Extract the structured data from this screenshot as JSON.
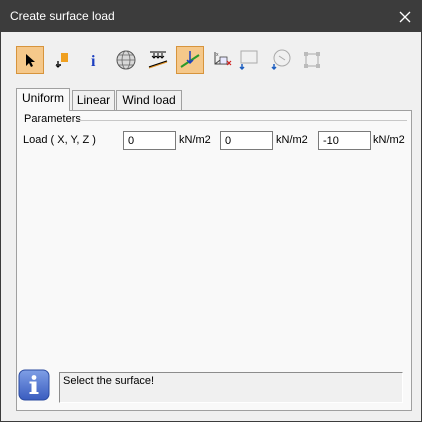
{
  "window": {
    "title": "Create surface load"
  },
  "toolbar": {
    "buttons": [
      {
        "icon": "select-arrow-icon",
        "active": true
      },
      {
        "icon": "surface-pick-icon",
        "active": false
      },
      {
        "icon": "info-icon",
        "active": false
      },
      {
        "icon": "sphere-icon",
        "active": false
      },
      {
        "icon": "load-arrows-icon",
        "active": false
      },
      {
        "icon": "surface-load-icon",
        "active": true
      },
      {
        "icon": "axes-icon",
        "active": false
      },
      {
        "icon": "rectangle-icon",
        "active": false
      },
      {
        "icon": "circle-icon",
        "active": false
      },
      {
        "icon": "polygon-icon",
        "active": false
      }
    ]
  },
  "tabs": [
    {
      "label": "Uniform",
      "selected": true
    },
    {
      "label": "Linear",
      "selected": false
    },
    {
      "label": "Wind load",
      "selected": false
    }
  ],
  "parameters": {
    "group_label": "Parameters",
    "load_label": "Load ( X, Y, Z )",
    "x_value": "0",
    "y_value": "0",
    "z_value": "-10",
    "unit": "kN/m2"
  },
  "status": {
    "message": "Select the surface!"
  },
  "colors": {
    "titlebar": "#3c3c3c",
    "active_button": "#f5c88a",
    "info_blue": "#4a6fc8"
  }
}
